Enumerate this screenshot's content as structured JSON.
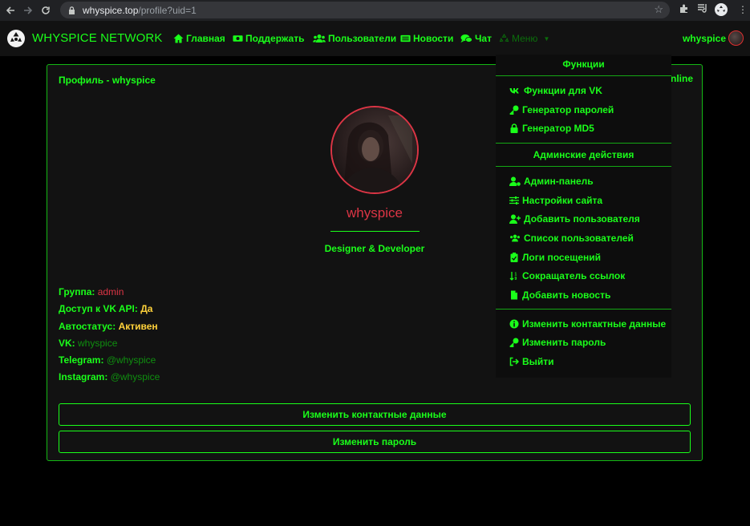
{
  "browser": {
    "url_host": "whyspice.top",
    "url_path": "/profile?uid=1"
  },
  "navbar": {
    "brand": "WHYSPICE NETWORK",
    "links": [
      "Главная",
      "Поддержать",
      "Пользователи",
      "Новости",
      "Чат"
    ],
    "menu_label": "Меню",
    "user": "whyspice"
  },
  "profile": {
    "card_title": "Профиль - whyspice",
    "status": "online",
    "name": "whyspice",
    "role": "Designer & Developer",
    "info": [
      {
        "label": "Группа:",
        "value": "admin"
      },
      {
        "label": "Доступ к VK API:",
        "value": "Да"
      },
      {
        "label": "Автостатус:",
        "value": "Активен"
      },
      {
        "label": "VK:",
        "value": "whyspice"
      },
      {
        "label": "Telegram:",
        "value": "@whyspice"
      },
      {
        "label": "Instagram:",
        "value": "@whyspice"
      }
    ],
    "buttons": [
      "Изменить контактные данные",
      "Изменить пароль"
    ]
  },
  "dropdown": {
    "functions_header": "Функции",
    "functions": [
      "Функции для VK",
      "Генератор паролей",
      "Генератор MD5"
    ],
    "admin_header": "Админские действия",
    "admin": [
      "Админ-панель",
      "Настройки сайта",
      "Добавить пользователя",
      "Список пользователей",
      "Логи посещений",
      "Сокращатель ссылок",
      "Добавить новость"
    ],
    "account": [
      "Изменить контактные данные",
      "Изменить пароль",
      "Выйти"
    ]
  },
  "colors": {
    "accent": "#1aff1a",
    "danger": "#dc3545",
    "warning": "#ffd23b",
    "background": "#000000",
    "panel": "#121212"
  },
  "icons": {
    "nav": [
      "home-icon",
      "money-icon",
      "users-icon",
      "newspaper-icon",
      "comments-icon",
      "recycle-icon"
    ],
    "dropdown": [
      "vk-icon",
      "key-icon",
      "lock-icon",
      "user-cog-icon",
      "sliders-icon",
      "user-plus-icon",
      "users-icon",
      "clipboard-icon",
      "sort-icon",
      "file-icon",
      "info-icon",
      "key-icon",
      "sign-out-icon"
    ]
  }
}
